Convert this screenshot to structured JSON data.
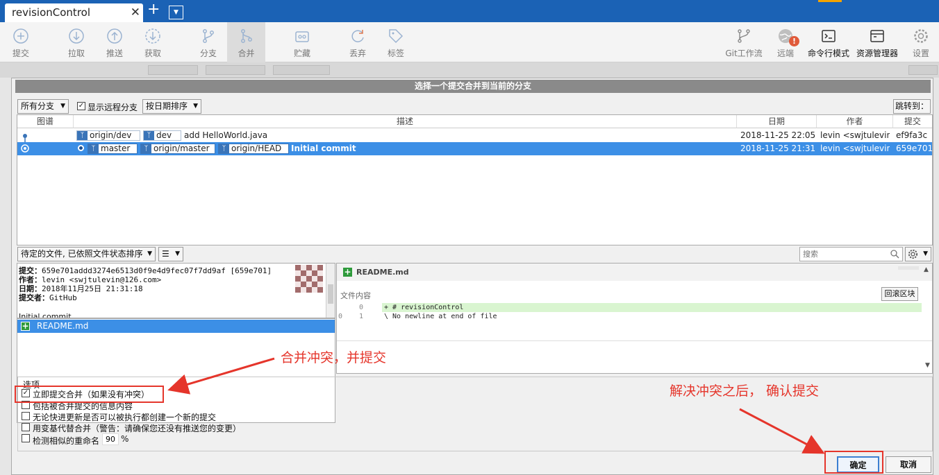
{
  "tabbar": {
    "tab_title": "revisionControl",
    "close_glyph": "✕",
    "add_glyph": "+",
    "dropdown_glyph": "▼"
  },
  "toolbar": {
    "left": [
      {
        "label": "提交",
        "icon": "commit-icon"
      },
      {
        "label": "拉取",
        "icon": "pull-icon"
      },
      {
        "label": "推送",
        "icon": "push-icon"
      },
      {
        "label": "获取",
        "icon": "fetch-icon"
      },
      {
        "label": "分支",
        "icon": "branch-icon"
      },
      {
        "label": "合并",
        "icon": "merge-icon"
      },
      {
        "label": "贮藏",
        "icon": "stash-icon"
      },
      {
        "label": "丢弃",
        "icon": "discard-icon"
      },
      {
        "label": "标签",
        "icon": "tag-icon"
      }
    ],
    "right": [
      {
        "label": "Git工作流",
        "icon": "git-flow-icon"
      },
      {
        "label": "远端",
        "icon": "remote-icon",
        "badge": "!"
      },
      {
        "label": "命令行模式",
        "icon": "terminal-icon"
      },
      {
        "label": "资源管理器",
        "icon": "explorer-icon"
      },
      {
        "label": "设置",
        "icon": "settings-icon"
      }
    ]
  },
  "background": {
    "branch_filter": "所有分支",
    "show_remote": "显示远程分支",
    "sort": "按日期排序",
    "jump": "跳转到"
  },
  "dialog": {
    "title": "选择一个提交合并到当前的分支",
    "branch_filter": "所有分支",
    "show_remote_label": "显示远程分支",
    "show_remote_checked": true,
    "sort": "按日期排序",
    "jump_button": "跳转到：",
    "columns": {
      "graph": "图谱",
      "desc": "描述",
      "date": "日期",
      "author": "作者",
      "commit": "提交"
    },
    "commits": [
      {
        "refs": [
          "origin/dev",
          "dev"
        ],
        "message": "add HelloWorld.java",
        "date": "2018-11-25 22:05",
        "author": "levin <swjtulevin@126.com>",
        "hash": "ef9fa3c",
        "selected": false
      },
      {
        "refs": [
          "master",
          "origin/master",
          "origin/HEAD"
        ],
        "message": "Initial commit",
        "date": "2018-11-25 21:31",
        "author": "levin <swjtulevin@126.com>",
        "hash": "659e701",
        "selected": true
      }
    ],
    "file_sort": "待定的文件, 已依照文件状态排序",
    "view_mode_glyph": "☰",
    "search_placeholder": "搜索",
    "details": {
      "commit_label": "提交：",
      "commit_value": "659e701addd3274e6513d0f9e4d9fec07f7dd9af [659e701]",
      "author_label": "作者：",
      "author_value": "levin <swjtulevin@126.com>",
      "date_label": "日期：",
      "date_value": "2018年11月25日 21:31:18",
      "committer_label": "提交者：",
      "committer_value": "GitHub",
      "message": "Initial commit"
    },
    "files": [
      {
        "name": "README.md",
        "status": "+"
      }
    ],
    "diff": {
      "file": "README.md",
      "section": "文件内容",
      "revert_button": "回滚区块",
      "lines": [
        {
          "old": "",
          "new": "0",
          "text": "+ # revisionControl",
          "added": true
        },
        {
          "old": "0",
          "new": "1",
          "text": "\\  No newline at end of file",
          "added": false
        }
      ]
    },
    "options_title": "选项",
    "options": [
      {
        "label": "立即提交合并（如果没有冲突）",
        "checked": true
      },
      {
        "label": "包括被合并提交的信息内容",
        "checked": false
      },
      {
        "label": "无论快进更新是否可以被执行都创建一个新的提交",
        "checked": false
      },
      {
        "label": "用变基代替合并（警告：请确保您还没有推送您的变更）",
        "checked": false
      },
      {
        "label": "检测相似的重命名",
        "checked": false
      }
    ],
    "rename_threshold": "90",
    "percent": "%",
    "ok": "确定",
    "cancel": "取消"
  },
  "annotations": {
    "merge_note": "合并冲突，并提交",
    "confirm_note": "解决冲突之后， 确认提交",
    "color": "#e5352b"
  }
}
